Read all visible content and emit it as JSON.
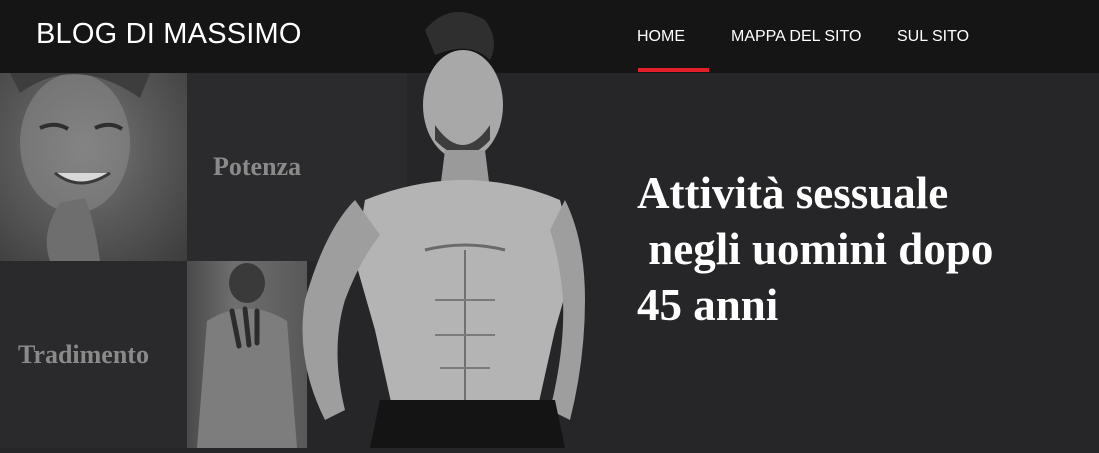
{
  "header": {
    "logo": "BLOG DI MASSIMO",
    "nav": [
      {
        "label": "HOME",
        "active": true
      },
      {
        "label": "MAPPA DEL SITO",
        "active": false
      },
      {
        "label": "SUL SITO",
        "active": false
      }
    ],
    "active_color": "#e3202a"
  },
  "tiles": {
    "potenza": "Potenza",
    "tradimento": "Tradimento"
  },
  "hero": {
    "headline_lines": [
      "Attività sessuale",
      " negli uomini dopo",
      "45 anni"
    ]
  }
}
